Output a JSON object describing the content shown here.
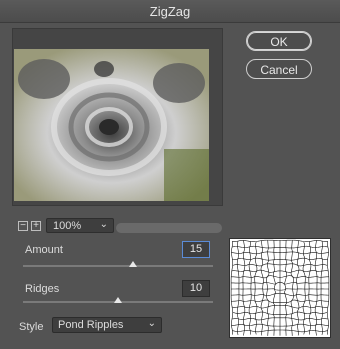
{
  "window": {
    "title": "ZigZag"
  },
  "buttons": {
    "ok": "OK",
    "cancel": "Cancel"
  },
  "zoom": {
    "minus": "−",
    "plus": "+",
    "value": "100%"
  },
  "params": {
    "amount": {
      "label": "Amount",
      "value": "15",
      "level": 0.58
    },
    "ridges": {
      "label": "Ridges",
      "value": "10",
      "level": 0.5
    }
  },
  "style": {
    "label": "Style",
    "value": "Pond Ripples"
  },
  "colors": {
    "accent": "#5b8bd6",
    "panel": "#535353",
    "field": "#3e3e3e"
  },
  "icons": [
    "zoom-out-icon",
    "zoom-in-icon",
    "chevron-down-icon"
  ]
}
